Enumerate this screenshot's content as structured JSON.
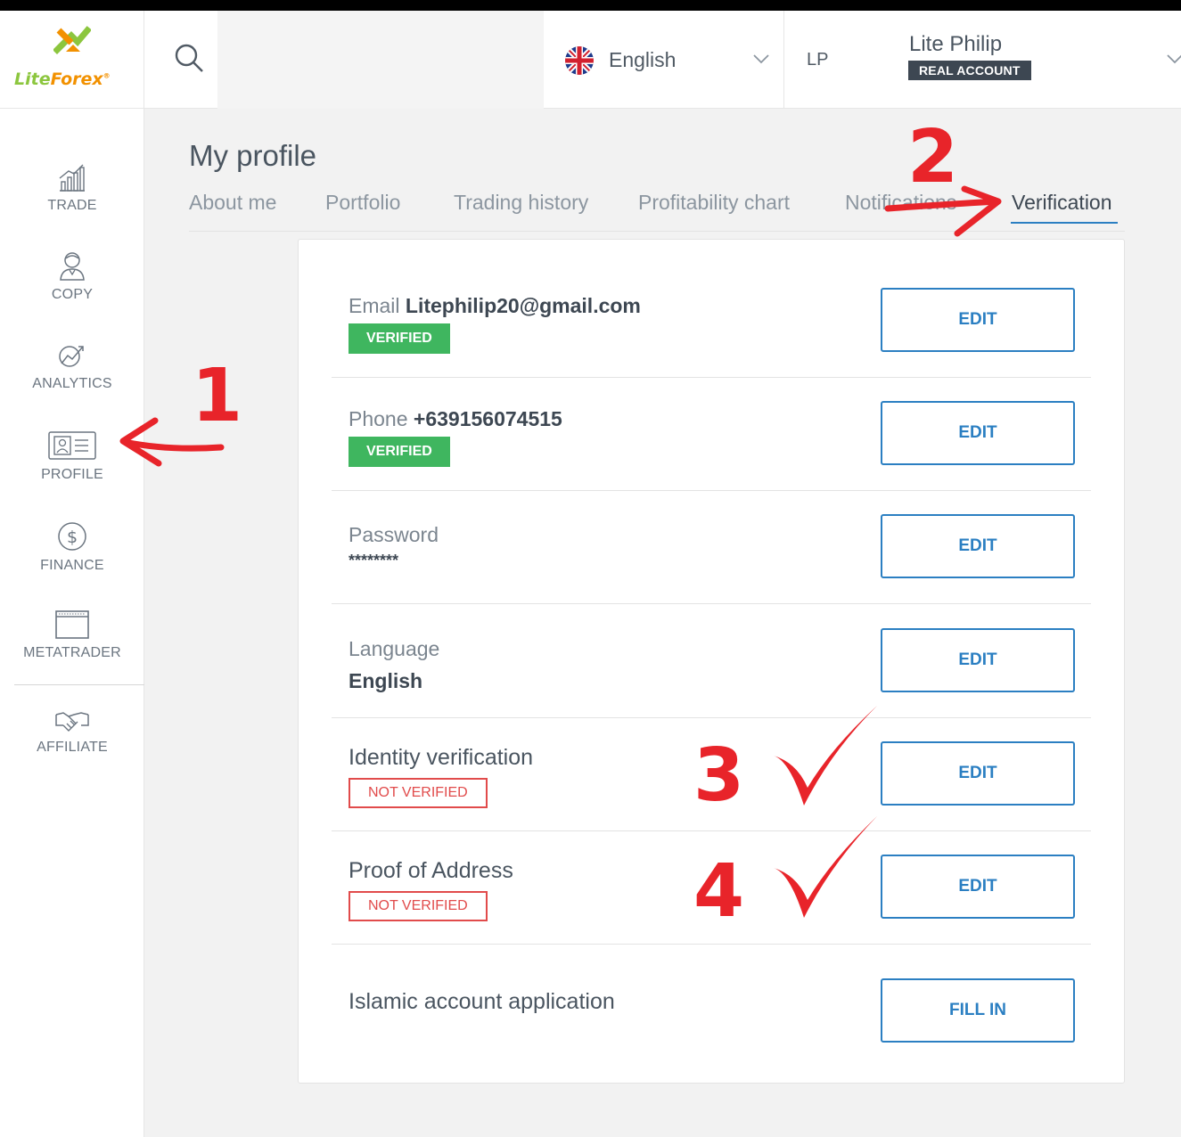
{
  "brand": {
    "logo_text_lite": "Lite",
    "logo_text_forex": "Forex",
    "logo_reg": "®"
  },
  "header": {
    "search_placeholder": "",
    "language_label": "English",
    "user_initials": "LP",
    "user_name": "Lite Philip",
    "account_badge": "REAL ACCOUNT"
  },
  "sidebar": {
    "items": [
      {
        "label": "TRADE",
        "icon": "trade-chart-icon"
      },
      {
        "label": "COPY",
        "icon": "copy-trader-icon"
      },
      {
        "label": "ANALYTICS",
        "icon": "analytics-icon"
      },
      {
        "label": "PROFILE",
        "icon": "profile-card-icon"
      },
      {
        "label": "FINANCE",
        "icon": "dollar-icon"
      },
      {
        "label": "METATRADER",
        "icon": "window-icon"
      },
      {
        "label": "AFFILIATE",
        "icon": "handshake-icon"
      }
    ]
  },
  "page": {
    "title": "My profile",
    "tabs": [
      {
        "label": "About me"
      },
      {
        "label": "Portfolio"
      },
      {
        "label": "Trading history"
      },
      {
        "label": "Profitability chart"
      },
      {
        "label": "Notifications"
      },
      {
        "label": "Verification",
        "active": true
      }
    ]
  },
  "verification": {
    "email": {
      "label": "Email",
      "value": "Litephilip20@gmail.com",
      "status": "VERIFIED",
      "button": "EDIT"
    },
    "phone": {
      "label": "Phone",
      "value": "+639156074515",
      "status": "VERIFIED",
      "button": "EDIT"
    },
    "password": {
      "label": "Password",
      "value": "********",
      "button": "EDIT"
    },
    "language": {
      "label": "Language",
      "value": "English",
      "button": "EDIT"
    },
    "identity": {
      "label": "Identity verification",
      "status": "NOT VERIFIED",
      "button": "EDIT"
    },
    "address": {
      "label": "Proof of Address",
      "status": "NOT VERIFIED",
      "button": "EDIT"
    },
    "islamic": {
      "label": "Islamic account application",
      "button": "FILL IN"
    }
  },
  "annotations": {
    "n1": "1",
    "n2": "2",
    "n3": "3",
    "n4": "4"
  },
  "colors": {
    "accent": "#2b7fc2",
    "verified": "#3fb65f",
    "not_verified": "#e14b4b",
    "annotation": "#e8242a",
    "logo_orange": "#f29100",
    "logo_green": "#8cc63e"
  }
}
